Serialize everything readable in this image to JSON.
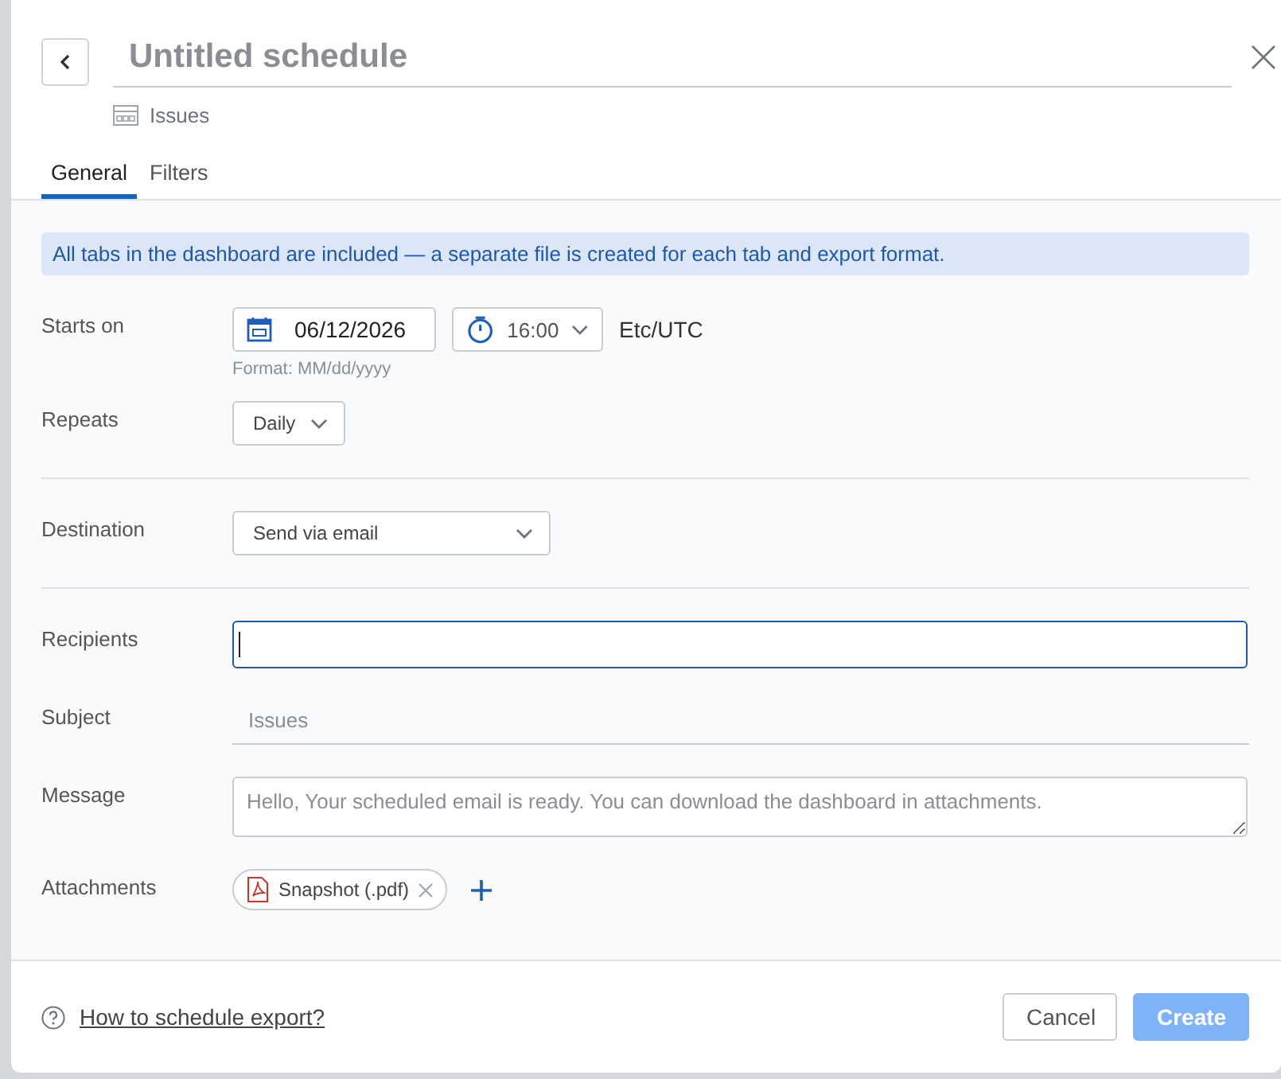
{
  "header": {
    "title_placeholder": "Untitled schedule",
    "source": "Issues"
  },
  "tabs": [
    {
      "label": "General",
      "selected": true
    },
    {
      "label": "Filters",
      "selected": false
    }
  ],
  "banner": "All tabs in the dashboard are included — a separate file is created for each tab and export format.",
  "starts_on": {
    "label": "Starts on",
    "date": "06/12/2026",
    "time": "16:00",
    "timezone": "Etc/UTC",
    "format_hint": "Format: MM/dd/yyyy"
  },
  "repeats": {
    "label": "Repeats",
    "value": "Daily"
  },
  "destination": {
    "label": "Destination",
    "value": "Send via email"
  },
  "recipients": {
    "label": "Recipients",
    "focused": true
  },
  "subject": {
    "label": "Subject",
    "placeholder": "Issues"
  },
  "message": {
    "label": "Message",
    "placeholder": "Hello, Your scheduled email is ready. You can download the dashboard in attachments."
  },
  "attachments": {
    "label": "Attachments",
    "items": [
      "Snapshot (.pdf)"
    ]
  },
  "footer": {
    "help_link": "How to schedule export?",
    "buttons": [
      {
        "label": "Cancel",
        "kind": "secondary",
        "disabled": false
      },
      {
        "label": "Create",
        "kind": "primary",
        "disabled": true
      }
    ]
  }
}
